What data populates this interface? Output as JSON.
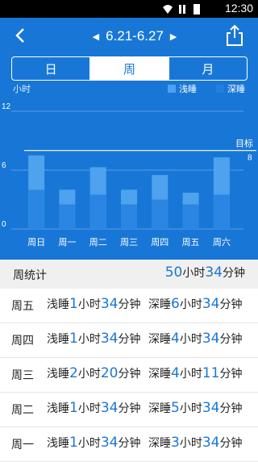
{
  "status": {
    "time": "12:30"
  },
  "header": {
    "date_range": "6.21-6.27",
    "prev_arrow": "◀",
    "next_arrow": "▶"
  },
  "tabs": [
    {
      "label": "日",
      "active": false
    },
    {
      "label": "周",
      "active": true
    },
    {
      "label": "月",
      "active": false
    }
  ],
  "unit_label": "小时",
  "legend": [
    {
      "label": "浅睡",
      "color": "#4ea2ee"
    },
    {
      "label": "深睡",
      "color": "#1f80e0"
    }
  ],
  "goal": {
    "label": "目标",
    "value": "8"
  },
  "chart_data": {
    "type": "bar",
    "categories": [
      "周日",
      "周一",
      "周二",
      "周三",
      "周四",
      "周五",
      "周六"
    ],
    "series": [
      {
        "name": "深睡",
        "values": [
          4.0,
          2.5,
          3.5,
          2.5,
          3.0,
          2.5,
          3.5
        ]
      },
      {
        "name": "浅睡",
        "values": [
          7.5,
          4.0,
          6.3,
          4.0,
          5.5,
          3.7,
          7.3
        ]
      }
    ],
    "ylim": [
      0,
      12
    ],
    "yticks": [
      "0",
      "6",
      "12"
    ],
    "goal_line": 8
  },
  "week_stats": {
    "label": "周统计",
    "hours": "50",
    "hours_unit": "小时",
    "minutes": "34",
    "minutes_unit": "分钟"
  },
  "daily_rows": [
    {
      "day": "周五",
      "light_label": "浅睡",
      "light_h": "1",
      "light_m": "34",
      "deep_label": "深睡",
      "deep_h": "6",
      "deep_m": "34"
    },
    {
      "day": "周四",
      "light_label": "浅睡",
      "light_h": "1",
      "light_m": "34",
      "deep_label": "深睡",
      "deep_h": "4",
      "deep_m": "34"
    },
    {
      "day": "周三",
      "light_label": "浅睡",
      "light_h": "2",
      "light_m": "20",
      "deep_label": "深睡",
      "deep_h": "4",
      "deep_m": "11"
    },
    {
      "day": "周二",
      "light_label": "浅睡",
      "light_h": "1",
      "light_m": "34",
      "deep_label": "深睡",
      "deep_h": "5",
      "deep_m": "34"
    },
    {
      "day": "周一",
      "light_label": "浅睡",
      "light_h": "1",
      "light_m": "34",
      "deep_label": "深睡",
      "deep_h": "3",
      "deep_m": "34"
    }
  ],
  "units": {
    "hour": "小时",
    "minute": "分钟"
  }
}
